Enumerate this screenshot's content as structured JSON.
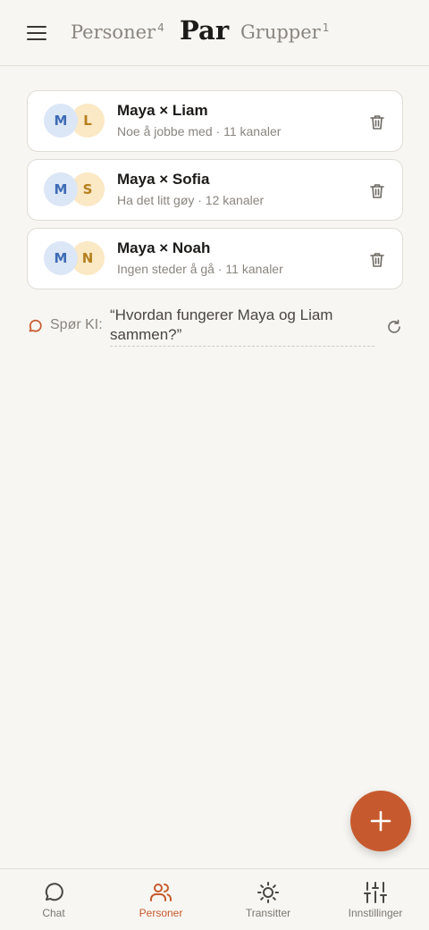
{
  "header": {
    "tabs": [
      {
        "label": "Personer",
        "count": "4"
      },
      {
        "label": "Par"
      },
      {
        "label": "Grupper",
        "count": "1"
      }
    ]
  },
  "pairs": [
    {
      "initial_a": "M",
      "initial_b": "L",
      "title": "Maya × Liam",
      "subtitle": "Noe å jobbe med · 11 kanaler"
    },
    {
      "initial_a": "M",
      "initial_b": "S",
      "title": "Maya × Sofia",
      "subtitle": "Ha det litt gøy · 12 kanaler"
    },
    {
      "initial_a": "M",
      "initial_b": "N",
      "title": "Maya × Noah",
      "subtitle": "Ingen steder å gå · 11 kanaler"
    }
  ],
  "ask": {
    "label": "Spør KI:",
    "question": "“Hvordan fungerer Maya og Liam sammen?”"
  },
  "bottom_nav": [
    {
      "label": "Chat",
      "icon": "chat-icon"
    },
    {
      "label": "Personer",
      "icon": "people-icon",
      "active": true
    },
    {
      "label": "Transitter",
      "icon": "sun-icon"
    },
    {
      "label": "Innstillinger",
      "icon": "sliders-icon"
    }
  ],
  "colors": {
    "accent": "#c65a2e",
    "background": "#f8f6f2",
    "avatar_a_bg": "#dbe6f6",
    "avatar_b_bg": "#fbe8c4"
  }
}
